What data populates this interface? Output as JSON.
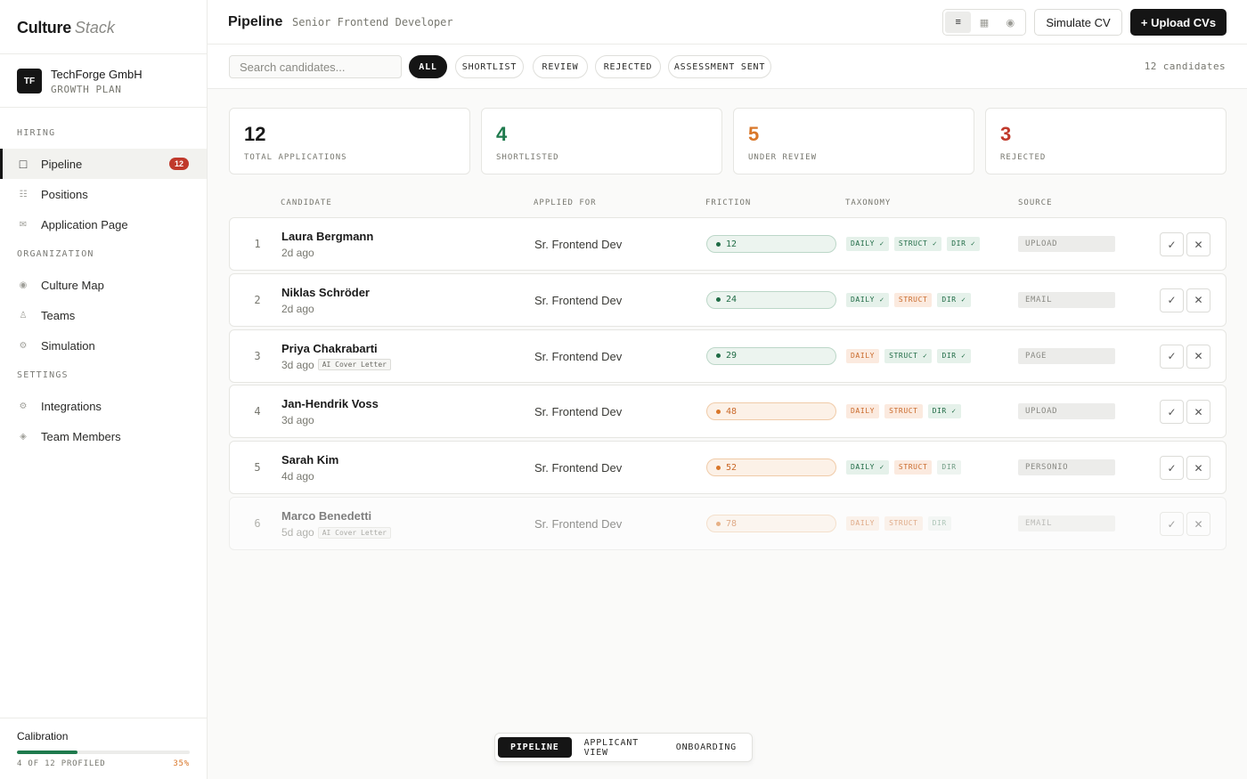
{
  "brand": {
    "word1": "Culture",
    "word2": "Stack"
  },
  "org": {
    "initials": "TF",
    "name": "TechForge GmbH",
    "plan": "GROWTH PLAN"
  },
  "sidebar": {
    "sections": [
      {
        "label": "HIRING",
        "items": [
          {
            "label": "Pipeline",
            "icon": "pipeline-square-icon",
            "badge": "12",
            "active": true
          },
          {
            "label": "Positions",
            "icon": "list-icon"
          },
          {
            "label": "Application Page",
            "icon": "envelope-icon"
          }
        ]
      },
      {
        "label": "ORGANIZATION",
        "items": [
          {
            "label": "Culture Map",
            "icon": "target-icon"
          },
          {
            "label": "Teams",
            "icon": "bell-icon"
          },
          {
            "label": "Simulation",
            "icon": "gear-icon"
          }
        ]
      },
      {
        "label": "SETTINGS",
        "items": [
          {
            "label": "Integrations",
            "icon": "gear-icon"
          },
          {
            "label": "Team Members",
            "icon": "diamond-icon"
          }
        ]
      }
    ],
    "calibration": {
      "title": "Calibration",
      "progress_text": "4 OF 12 PROFILED",
      "percent_text": "35%",
      "progress": 0.35
    }
  },
  "header": {
    "title": "Pipeline",
    "subtitle": "Senior Frontend Developer",
    "view_icons": [
      "list-icon",
      "grid-icon",
      "radar-icon"
    ],
    "simulate_label": "Simulate CV",
    "upload_label": "+ Upload CVs"
  },
  "filters": {
    "search_placeholder": "Search candidates...",
    "chips": [
      "ALL",
      "SHORTLIST",
      "REVIEW",
      "REJECTED",
      "ASSESSMENT SENT"
    ],
    "active_chip": "ALL",
    "count_text": "12 candidates"
  },
  "stats": [
    {
      "value": "12",
      "label": "TOTAL APPLICATIONS",
      "color": "#1a1a1a"
    },
    {
      "value": "4",
      "label": "SHORTLISTED",
      "color": "#1f7a4d"
    },
    {
      "value": "5",
      "label": "UNDER REVIEW",
      "color": "#d9772a"
    },
    {
      "value": "3",
      "label": "REJECTED",
      "color": "#c0392b"
    }
  ],
  "table": {
    "columns": [
      "CANDIDATE",
      "APPLIED FOR",
      "FRICTION",
      "TAXONOMY",
      "SOURCE"
    ],
    "rows": [
      {
        "idx": "1",
        "name": "Laura Bergmann",
        "time": "2d ago",
        "tag": "",
        "position": "Sr. Frontend Dev",
        "friction": "12",
        "friction_tone": "green",
        "taxonomy": [
          {
            "t": "DAILY ✓",
            "s": "ok"
          },
          {
            "t": "STRUCT ✓",
            "s": "ok"
          },
          {
            "t": "DIR ✓",
            "s": "ok"
          }
        ],
        "source": "UPLOAD",
        "dim": false
      },
      {
        "idx": "2",
        "name": "Niklas Schröder",
        "time": "2d ago",
        "tag": "",
        "position": "Sr. Frontend Dev",
        "friction": "24",
        "friction_tone": "green",
        "taxonomy": [
          {
            "t": "DAILY ✓",
            "s": "ok"
          },
          {
            "t": "STRUCT",
            "s": "warn"
          },
          {
            "t": "DIR ✓",
            "s": "ok"
          }
        ],
        "source": "EMAIL",
        "dim": false
      },
      {
        "idx": "3",
        "name": "Priya Chakrabarti",
        "time": "3d ago",
        "tag": "AI Cover Letter",
        "position": "Sr. Frontend Dev",
        "friction": "29",
        "friction_tone": "green",
        "taxonomy": [
          {
            "t": "DAILY",
            "s": "warn"
          },
          {
            "t": "STRUCT ✓",
            "s": "ok"
          },
          {
            "t": "DIR ✓",
            "s": "ok"
          }
        ],
        "source": "PAGE",
        "dim": false
      },
      {
        "idx": "4",
        "name": "Jan-Hendrik Voss",
        "time": "3d ago",
        "tag": "",
        "position": "Sr. Frontend Dev",
        "friction": "48",
        "friction_tone": "orange",
        "taxonomy": [
          {
            "t": "DAILY",
            "s": "warn"
          },
          {
            "t": "STRUCT",
            "s": "warn"
          },
          {
            "t": "DIR ✓",
            "s": "ok"
          }
        ],
        "source": "UPLOAD",
        "dim": false
      },
      {
        "idx": "5",
        "name": "Sarah Kim",
        "time": "4d ago",
        "tag": "",
        "position": "Sr. Frontend Dev",
        "friction": "52",
        "friction_tone": "orange",
        "taxonomy": [
          {
            "t": "DAILY ✓",
            "s": "ok"
          },
          {
            "t": "STRUCT",
            "s": "warn"
          },
          {
            "t": "DIR",
            "s": "plain"
          }
        ],
        "source": "PERSONIO",
        "dim": false
      },
      {
        "idx": "6",
        "name": "Marco Benedetti",
        "time": "5d ago",
        "tag": "AI Cover Letter",
        "position": "Sr. Frontend Dev",
        "friction": "78",
        "friction_tone": "orange",
        "taxonomy": [
          {
            "t": "DAILY",
            "s": "warn"
          },
          {
            "t": "STRUCT",
            "s": "warn"
          },
          {
            "t": "DIR",
            "s": "plain"
          }
        ],
        "source": "EMAIL",
        "dim": true
      }
    ],
    "approve_glyph": "✓",
    "reject_glyph": "✕"
  },
  "switcher": {
    "tabs": [
      "PIPELINE",
      "APPLICANT VIEW",
      "ONBOARDING"
    ],
    "active": "PIPELINE"
  }
}
